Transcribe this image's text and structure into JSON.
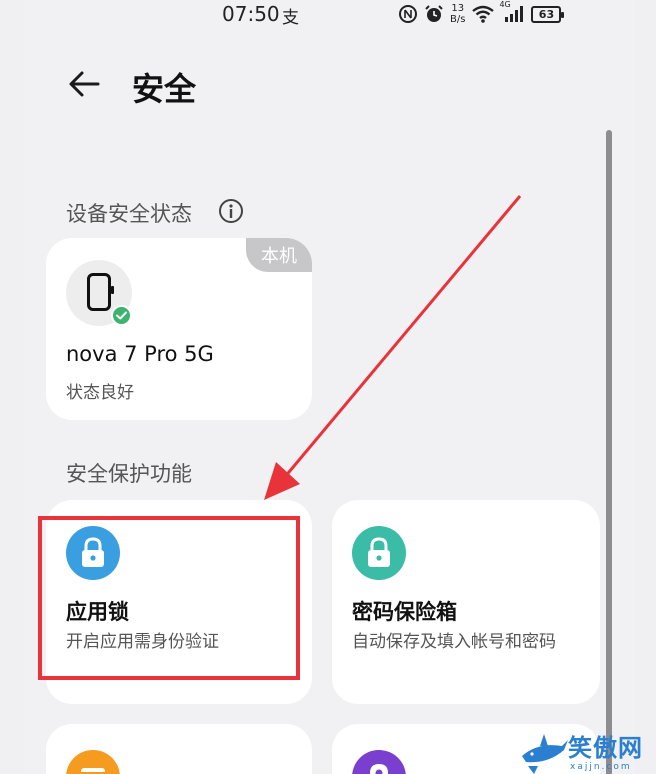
{
  "status_bar": {
    "time": "07:50",
    "notification": "支",
    "net_speed_value": "13",
    "net_speed_unit": "B/s",
    "network_type": "4G",
    "battery": "63",
    "icons": [
      "nfc-icon",
      "alarm-icon",
      "wifi-icon",
      "signal-icon",
      "battery-icon"
    ]
  },
  "header": {
    "back_icon": "back-arrow-icon",
    "title": "安全"
  },
  "device_section": {
    "title": "设备安全状态",
    "info_icon": "info-icon",
    "device": {
      "badge": "本机",
      "name": "nova 7 Pro 5G",
      "status": "状态良好",
      "icon": "phone-icon",
      "status_icon": "check-icon",
      "status_color": "#3cb46e"
    }
  },
  "protection_section": {
    "title": "安全保护功能",
    "features": [
      {
        "name": "应用锁",
        "desc": "开启应用需身份验证",
        "icon": "lock-icon",
        "color": "#3a9fe0"
      },
      {
        "name": "密码保险箱",
        "desc": "自动保存及填入帐号和密码",
        "icon": "lock-icon",
        "color": "#3bbca7"
      },
      {
        "icon": "card-icon",
        "color": "#f59b1f"
      },
      {
        "icon": "location-pin-icon",
        "color": "#7a3fcf"
      }
    ]
  },
  "annotation": {
    "highlight_color": "#e8333a"
  },
  "watermark": {
    "text": "笑傲网",
    "sub": "xajjn.com",
    "icon": "shark-logo-icon"
  }
}
